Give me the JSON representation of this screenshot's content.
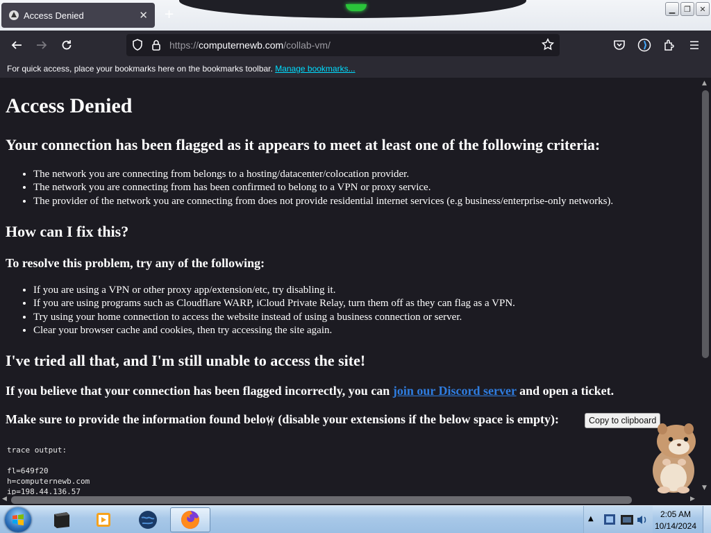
{
  "browser": {
    "tab": {
      "title": "Access Denied",
      "close_glyph": "✕"
    },
    "new_tab_glyph": "+",
    "url": {
      "prefix": "https://",
      "host": "computernewb.com",
      "path": "/collab-vm/"
    },
    "bookmarks_bar": {
      "text": "For quick access, place your bookmarks here on the bookmarks toolbar.",
      "link": "Manage bookmarks..."
    }
  },
  "page": {
    "title": "Access Denied",
    "criteria_heading": "Your connection has been flagged as it appears to meet at least one of the following criteria:",
    "criteria": [
      "The network you are connecting from belongs to a hosting/datacenter/colocation provider.",
      "The network you are connecting from has been confirmed to belong to a VPN or proxy service.",
      "The provider of the network you are connecting from does not provide residential internet services (e.g business/enterprise-only networks)."
    ],
    "fix_heading": "How can I fix this?",
    "resolve_heading": "To resolve this problem, try any of the following:",
    "fixes": [
      "If you are using a VPN or other proxy app/extension/etc, try disabling it.",
      "If you are using programs such as Cloudflare WARP, iCloud Private Relay, turn them off as they can flag as a VPN.",
      "Try using your home connection to access the website instead of using a business connection or server.",
      "Clear your browser cache and cookies, then try accessing the site again."
    ],
    "tried_heading": "I've tried all that, and I'm still unable to access the site!",
    "ticket_pre": "If you believe that your connection has been flagged incorrectly, you can ",
    "ticket_link": "join our Discord server",
    "ticket_post": " and open a ticket.",
    "info_text": "Make sure to provide the information found below (disable your extensions if the below space is empty):",
    "copy_button": "Copy to clipboard",
    "trace": "trace output:\n\nfl=649f20\nh=computernewb.com\nip=198.44.136.57"
  },
  "taskbar": {
    "time": "2:05 AM",
    "date": "10/14/2024"
  },
  "colors": {
    "page_bg": "#1c1b22",
    "toolbar_bg": "#2b2a33",
    "link": "#00ddff",
    "discord_link": "#2f7de0"
  }
}
